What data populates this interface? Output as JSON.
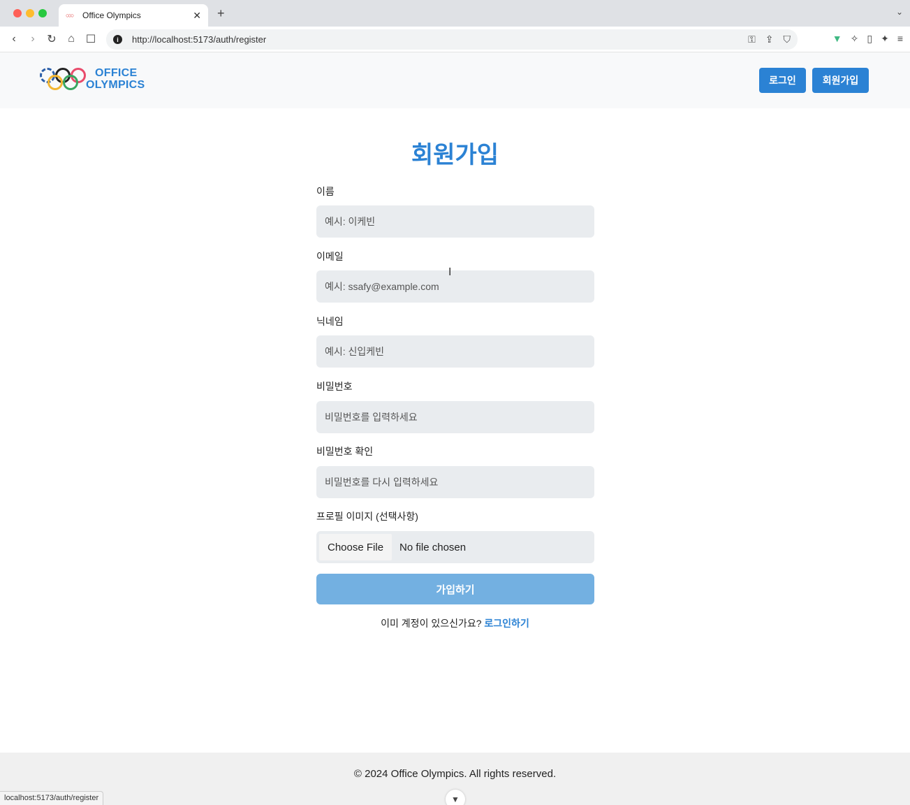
{
  "browser": {
    "tab_title": "Office Olympics",
    "tab_favicon": "olympic-rings-favicon",
    "url": "http://localhost:5173/auth/register",
    "status_url": "localhost:5173/auth/register"
  },
  "header": {
    "logo_line1": "OFFICE",
    "logo_line2": "OLYMPICS",
    "login_label": "로그인",
    "register_label": "회원가입"
  },
  "form": {
    "title": "회원가입",
    "name_label": "이름",
    "name_placeholder": "예시: 이케빈",
    "email_label": "이메일",
    "email_placeholder": "예시: ssafy@example.com",
    "nickname_label": "닉네임",
    "nickname_placeholder": "예시: 신입케빈",
    "password_label": "비밀번호",
    "password_placeholder": "비밀번호를 입력하세요",
    "password_confirm_label": "비밀번호 확인",
    "password_confirm_placeholder": "비밀번호를 다시 입력하세요",
    "profile_label": "프로필 이미지 (선택사항)",
    "choose_file_label": "Choose File",
    "no_file_label": "No file chosen",
    "submit_label": "가입하기",
    "login_prompt": "이미 계정이 있으신가요?",
    "login_link": "로그인하기"
  },
  "footer": {
    "text": "© 2024 Office Olympics. All rights reserved."
  },
  "colors": {
    "primary": "#2b82d4",
    "submit_disabled": "#73b0e1",
    "input_bg": "#e9ecef"
  }
}
